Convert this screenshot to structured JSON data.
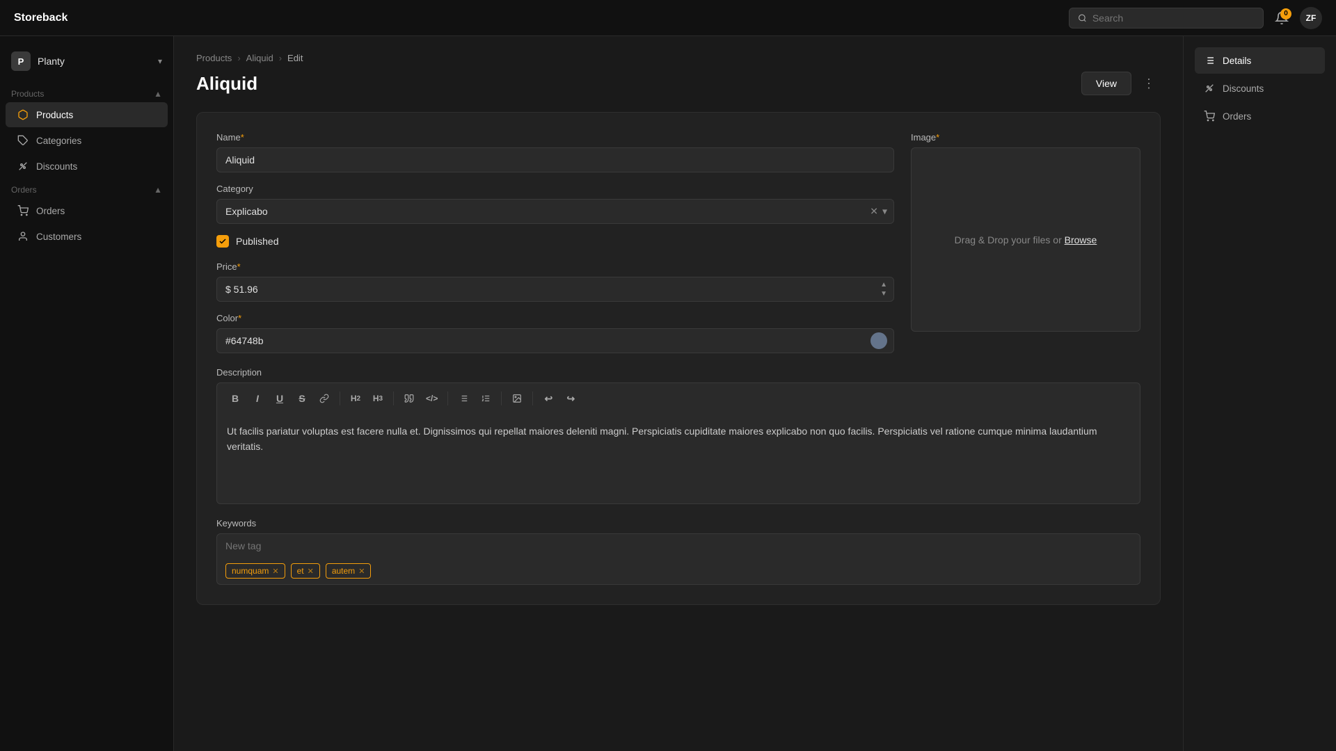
{
  "app": {
    "name": "Storeback"
  },
  "topbar": {
    "search_placeholder": "Search",
    "notification_count": "0",
    "avatar_initials": "ZF"
  },
  "sidebar": {
    "store_initial": "P",
    "store_name": "Planty",
    "products_section": "Products",
    "orders_section": "Orders",
    "items": [
      {
        "id": "products",
        "label": "Products",
        "active": true
      },
      {
        "id": "categories",
        "label": "Categories",
        "active": false
      },
      {
        "id": "discounts",
        "label": "Discounts",
        "active": false
      },
      {
        "id": "orders",
        "label": "Orders",
        "active": false
      },
      {
        "id": "customers",
        "label": "Customers",
        "active": false
      }
    ]
  },
  "breadcrumb": {
    "items": [
      "Products",
      "Aliquid",
      "Edit"
    ]
  },
  "page": {
    "title": "Aliquid",
    "view_button": "View"
  },
  "form": {
    "name_label": "Name",
    "name_value": "Aliquid",
    "category_label": "Category",
    "category_value": "Explicabo",
    "published_label": "Published",
    "price_label": "Price",
    "price_value": "$ 51.96",
    "color_label": "Color",
    "color_value": "#64748b",
    "color_hex": "#64748b",
    "description_label": "Description",
    "description_text": "Ut facilis pariatur voluptas est facere nulla et. Dignissimos qui repellat maiores deleniti magni. Perspiciatis cupiditate maiores explicabo non quo facilis. Perspiciatis vel ratione cumque minima laudantium veritatis.",
    "image_label": "Image",
    "image_upload_text": "Drag & Drop your files or ",
    "image_browse_label": "Browse",
    "keywords_label": "Keywords",
    "keywords_placeholder": "New tag",
    "tags": [
      "numquam",
      "et",
      "autem"
    ]
  },
  "right_panel": {
    "items": [
      {
        "id": "details",
        "label": "Details",
        "active": true
      },
      {
        "id": "discounts",
        "label": "Discounts",
        "active": false
      },
      {
        "id": "orders",
        "label": "Orders",
        "active": false
      }
    ]
  },
  "toolbar": {
    "bold": "B",
    "italic": "I",
    "underline": "U",
    "strikethrough": "S",
    "link": "🔗",
    "h2": "H₂",
    "h3": "H₃",
    "quote": "❝",
    "code": "</>",
    "ul": "≡",
    "ol": "1.",
    "image": "🖼",
    "undo": "↩",
    "redo": "↪"
  }
}
